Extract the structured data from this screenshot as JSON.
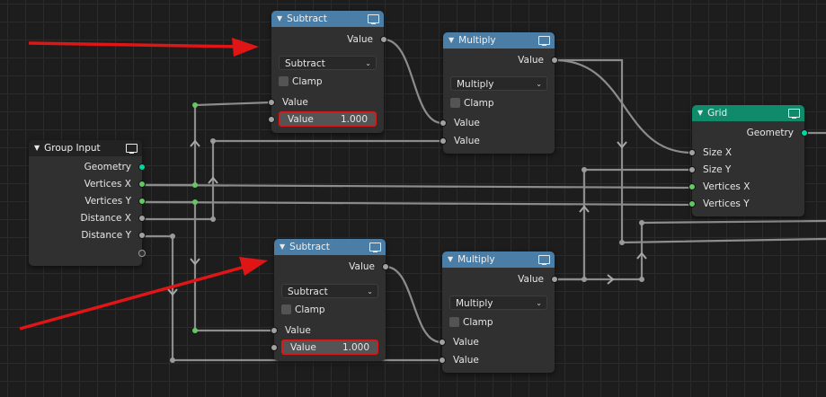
{
  "colors": {
    "background": "#1d1d1d",
    "node_body": "#303030",
    "math_header": "#4b7ea6",
    "group_input_header": "#222222",
    "geometry_header": "#0f8b6c",
    "socket_float": "#a1a1a1",
    "socket_vector_int": "#63c763",
    "socket_geometry": "#00d6a3",
    "annotation_red": "#e01515"
  },
  "group_input": {
    "title": "Group Input",
    "outputs": [
      "Geometry",
      "Vertices X",
      "Vertices Y",
      "Distance X",
      "Distance Y"
    ]
  },
  "subtract_top": {
    "title": "Subtract",
    "output": "Value",
    "operation": "Subtract",
    "clamp_label": "Clamp",
    "input_label": "Value",
    "field_label": "Value",
    "field_value": "1.000"
  },
  "subtract_bottom": {
    "title": "Subtract",
    "output": "Value",
    "operation": "Subtract",
    "clamp_label": "Clamp",
    "input_label": "Value",
    "field_label": "Value",
    "field_value": "1.000"
  },
  "multiply_top": {
    "title": "Multiply",
    "output": "Value",
    "operation": "Multiply",
    "clamp_label": "Clamp",
    "inputs": [
      "Value",
      "Value"
    ]
  },
  "multiply_bottom": {
    "title": "Multiply",
    "output": "Value",
    "operation": "Multiply",
    "clamp_label": "Clamp",
    "inputs": [
      "Value",
      "Value"
    ]
  },
  "grid": {
    "title": "Grid",
    "output": "Geometry",
    "inputs": [
      "Size X",
      "Size Y",
      "Vertices X",
      "Vertices Y"
    ]
  }
}
